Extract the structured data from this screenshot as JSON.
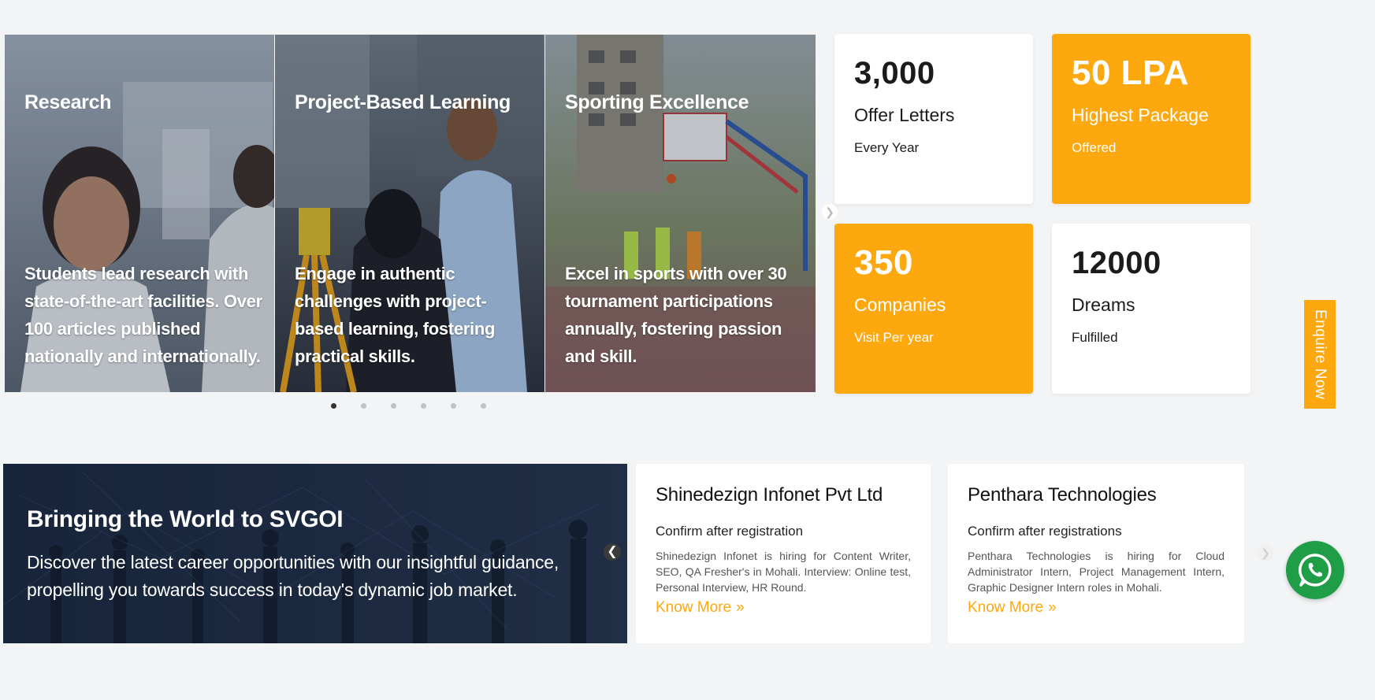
{
  "highlights": {
    "cards": [
      {
        "title": "Research",
        "description": "Students lead research with state-of-the-art facilities. Over 100 articles published nationally and internationally."
      },
      {
        "title": "Project-Based Learning",
        "description": "Engage in authentic challenges with project-based learning, fostering practical skills."
      },
      {
        "title": "Sporting Excellence",
        "description": "Excel in sports with over 30 tournament participations annually, fostering passion and skill."
      }
    ],
    "dot_count": 6,
    "active_dot": 1
  },
  "stats": [
    {
      "number": "3,000",
      "label": "Offer Letters",
      "sub": "Every Year"
    },
    {
      "number": "50 LPA",
      "label": "Highest Package",
      "sub": "Offered"
    },
    {
      "number": "350",
      "label": "Companies",
      "sub": "Visit Per year"
    },
    {
      "number": "12000",
      "label": "Dreams",
      "sub": "Fulfilled"
    }
  ],
  "enquire": {
    "label": "Enquire Now"
  },
  "banner": {
    "title": "Bringing the World to SVGOI",
    "description": "Discover the latest career opportunities with our insightful guidance, propelling you towards success in today's dynamic job market."
  },
  "jobs": [
    {
      "company": "Shinedezign Infonet Pvt Ltd",
      "status": "Confirm after registration",
      "description": "Shinedezign Infonet is hiring for Content Writer, SEO, QA Fresher's in Mohali. Interview: Online test, Personal Interview, HR Round.",
      "link": "Know More"
    },
    {
      "company": "Penthara Technologies",
      "status": "Confirm after registrations",
      "description": "Penthara Technologies is hiring for Cloud Administrator Intern, Project Management Intern, Graphic Designer Intern roles in Mohali.",
      "link": "Know More"
    }
  ],
  "colors": {
    "accent": "#fda80f",
    "whatsapp": "#1f9d47",
    "background": "#f3f4f6"
  },
  "icons": {
    "next": "chevron-right-icon",
    "prev": "chevron-left-icon",
    "link": "double-chevron-right-icon",
    "whatsapp": "whatsapp-icon"
  }
}
